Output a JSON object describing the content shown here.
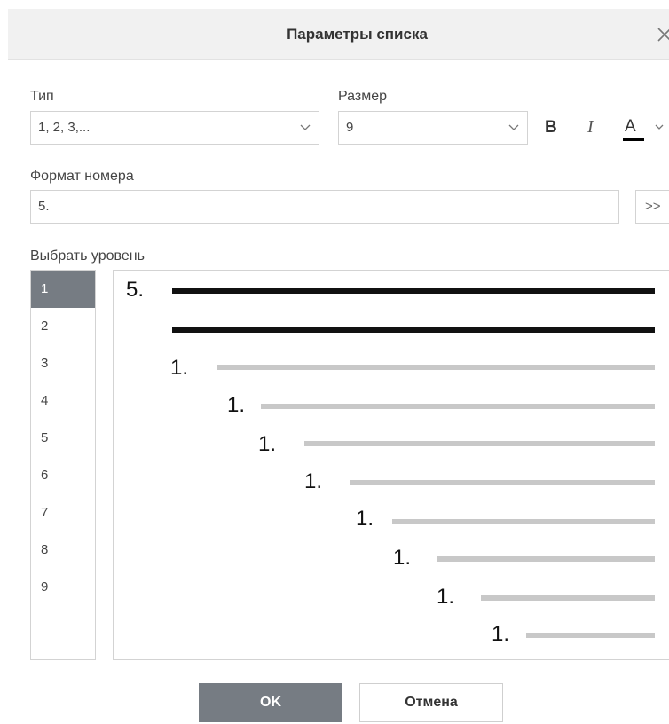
{
  "dialog": {
    "title": "Параметры списка",
    "close_icon": "close-icon"
  },
  "type": {
    "label": "Тип",
    "value": "1, 2, 3,..."
  },
  "size": {
    "label": "Размер",
    "value": "9"
  },
  "font_format": {
    "bold_label": "B",
    "italic_label": "I",
    "color_label": "A"
  },
  "number_format": {
    "label": "Формат номера",
    "value": "5.",
    "insert_label": ">>"
  },
  "levels": {
    "label": "Выбрать уровень",
    "items": [
      "1",
      "2",
      "3",
      "4",
      "5",
      "6",
      "7",
      "8",
      "9"
    ],
    "selected": "1"
  },
  "preview": {
    "rows": [
      "5.",
      "",
      "1.",
      "1.",
      "1.",
      "1.",
      "1.",
      "1.",
      "1."
    ]
  },
  "buttons": {
    "ok": "OK",
    "cancel": "Отмена"
  },
  "colors": {
    "accent": "#767c83",
    "active_line": "#111111",
    "inactive_line": "#c8c8c8"
  }
}
